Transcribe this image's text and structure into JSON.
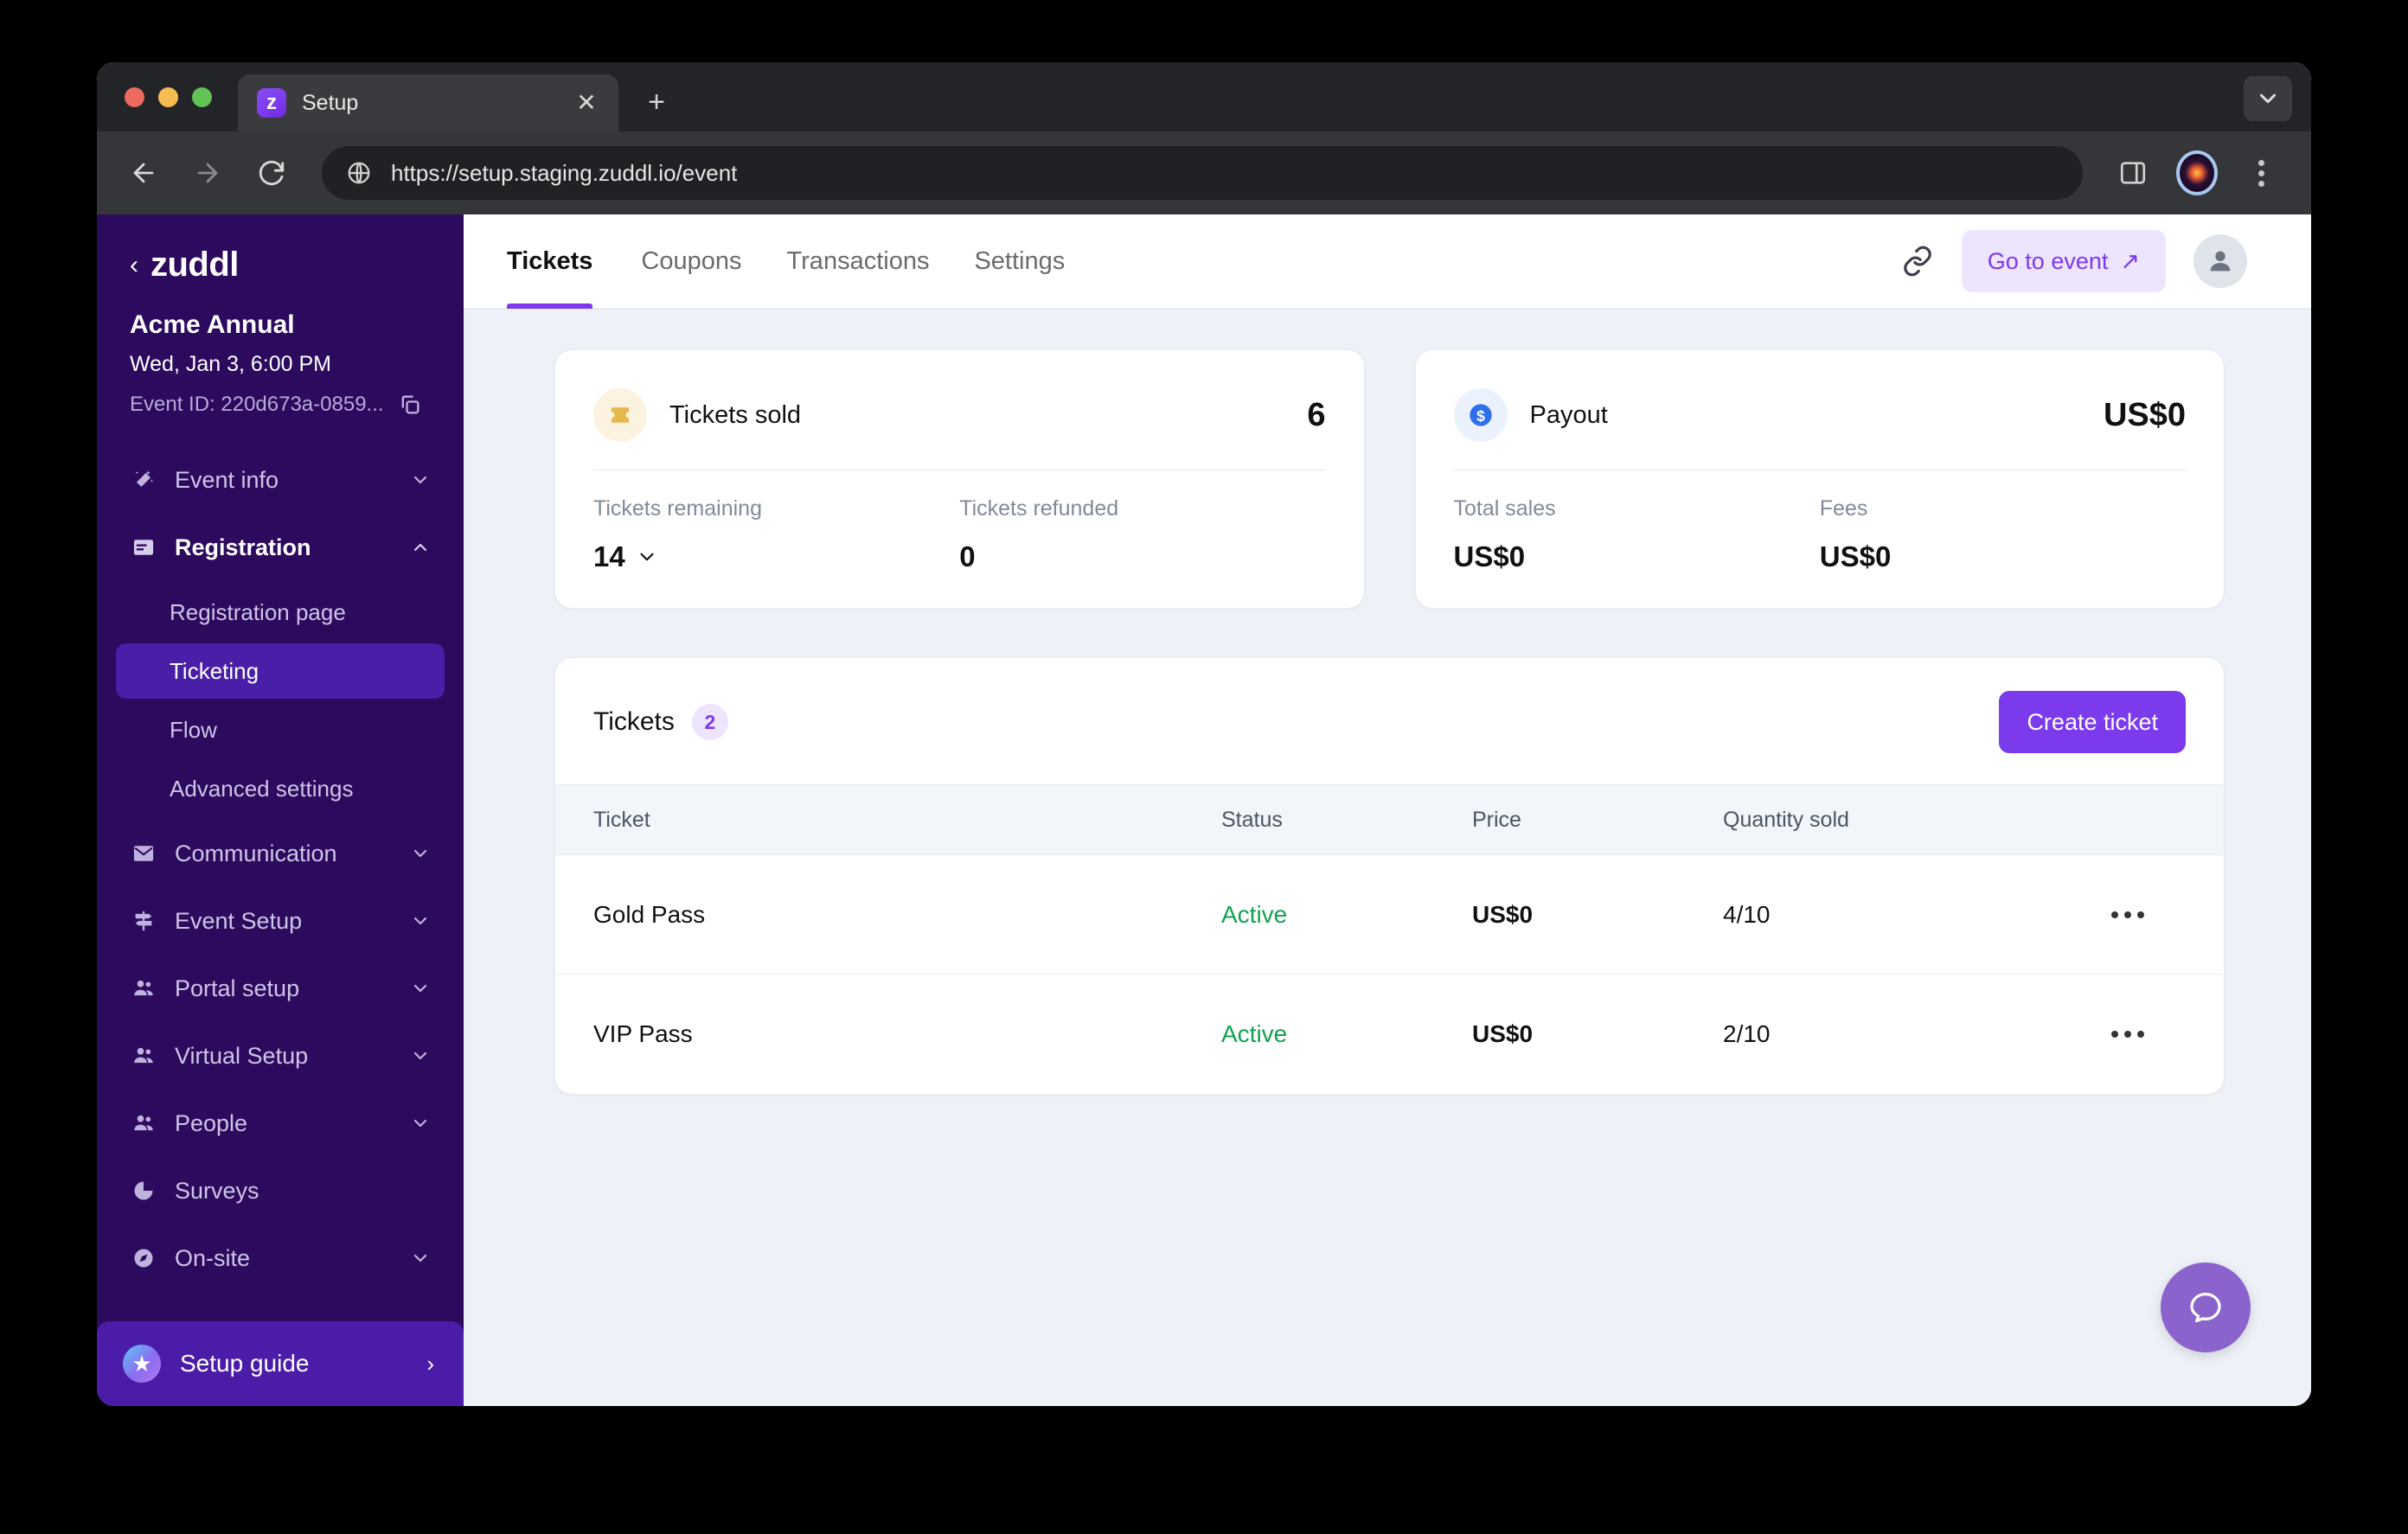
{
  "browser": {
    "tab": {
      "title": "Setup",
      "favicon_letter": "z"
    },
    "url": "https://setup.staging.zuddl.io/event",
    "controls": {
      "back": "back-arrow",
      "forward": "forward-arrow",
      "reload": "reload-icon",
      "side_panel": "side-panel-icon",
      "profile": "profile-avatar",
      "menu": "kebab-menu-icon",
      "tab_list": "chevron-down-icon",
      "new_tab": "+",
      "close_tab": "✕"
    }
  },
  "sidebar": {
    "brand": "zuddl",
    "back_chevron": "‹",
    "event_name": "Acme Annual",
    "event_date": "Wed, Jan 3, 6:00 PM",
    "event_id": "Event ID: 220d673a-0859...",
    "nav": [
      {
        "label": "Event info",
        "icon": "magic-wand-icon",
        "expandable": true,
        "expanded": false
      },
      {
        "label": "Registration",
        "icon": "form-card-icon",
        "expandable": true,
        "expanded": true,
        "children": [
          {
            "label": "Registration page",
            "selected": false
          },
          {
            "label": "Ticketing",
            "selected": true
          },
          {
            "label": "Flow",
            "selected": false
          },
          {
            "label": "Advanced settings",
            "selected": false
          }
        ]
      },
      {
        "label": "Communication",
        "icon": "envelope-icon",
        "expandable": true,
        "expanded": false
      },
      {
        "label": "Event Setup",
        "icon": "signpost-icon",
        "expandable": true,
        "expanded": false
      },
      {
        "label": "Portal setup",
        "icon": "people-icon",
        "expandable": true,
        "expanded": false
      },
      {
        "label": "Virtual Setup",
        "icon": "people-icon",
        "expandable": true,
        "expanded": false
      },
      {
        "label": "People",
        "icon": "people-icon",
        "expandable": true,
        "expanded": false
      },
      {
        "label": "Surveys",
        "icon": "pie-chart-icon",
        "expandable": false,
        "expanded": false
      },
      {
        "label": "On-site",
        "icon": "compass-icon",
        "expandable": true,
        "expanded": false
      }
    ],
    "setup_guide": {
      "label": "Setup guide",
      "icon": "star-icon",
      "arrow": "›"
    }
  },
  "topbar": {
    "tabs": [
      {
        "label": "Tickets",
        "active": true
      },
      {
        "label": "Coupons",
        "active": false
      },
      {
        "label": "Transactions",
        "active": false
      },
      {
        "label": "Settings",
        "active": false
      }
    ],
    "link_icon": "chain-link-icon",
    "go_to_event": {
      "label": "Go to event",
      "arrow": "↗"
    },
    "avatar": "user-avatar-icon"
  },
  "stats": {
    "tickets_sold": {
      "icon": "ticket-icon",
      "title": "Tickets sold",
      "value": "6",
      "subs": [
        {
          "label": "Tickets remaining",
          "value": "14",
          "has_caret": true
        },
        {
          "label": "Tickets refunded",
          "value": "0",
          "has_caret": false
        }
      ]
    },
    "payout": {
      "icon": "dollar-coin-icon",
      "title": "Payout",
      "value": "US$0",
      "subs": [
        {
          "label": "Total sales",
          "value": "US$0",
          "has_caret": false
        },
        {
          "label": "Fees",
          "value": "US$0",
          "has_caret": false
        }
      ]
    }
  },
  "tickets_table": {
    "title": "Tickets",
    "count": "2",
    "create_label": "Create ticket",
    "columns": [
      "Ticket",
      "Status",
      "Price",
      "Quantity sold",
      ""
    ],
    "rows": [
      {
        "ticket": "Gold Pass",
        "status": "Active",
        "price": "US$0",
        "quantity_sold": "4/10",
        "menu": "more-options-icon"
      },
      {
        "ticket": "VIP Pass",
        "status": "Active",
        "price": "US$0",
        "quantity_sold": "2/10",
        "menu": "more-options-icon"
      }
    ]
  },
  "help": {
    "icon": "chat-bubble-icon"
  },
  "colors": {
    "accent_purple": "#7C3AED",
    "sidebar_bg": "#2C0A5E",
    "sidebar_selected": "#4A1FA8",
    "status_active_green": "#12A150",
    "page_bg": "#EEF1F7",
    "ticket_icon_amber": "#E5B84B",
    "payout_icon_blue": "#2F6FED"
  }
}
